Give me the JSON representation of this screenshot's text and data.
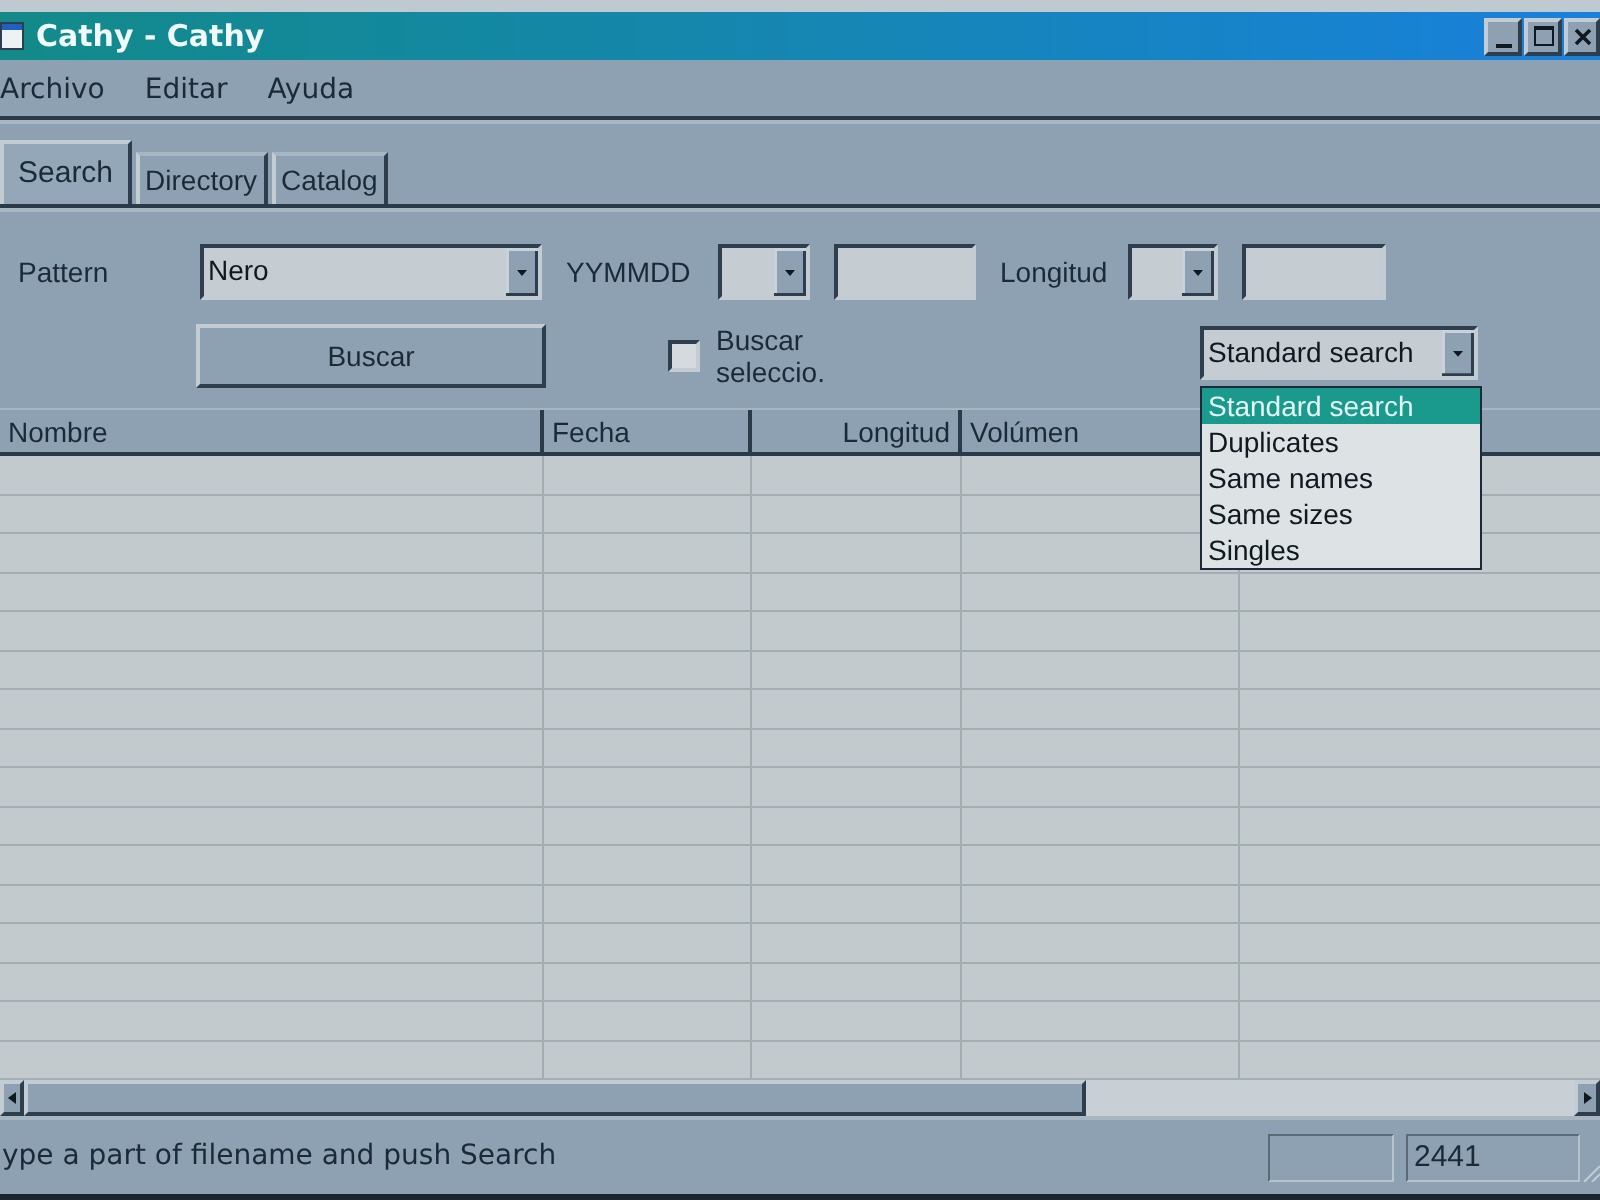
{
  "window": {
    "title": "Cathy - Cathy"
  },
  "menu": [
    "Archivo",
    "Editar",
    "Ayuda"
  ],
  "tabs": [
    {
      "label": "Search",
      "selected": true
    },
    {
      "label": "Directory",
      "selected": false
    },
    {
      "label": "Catalog",
      "selected": false
    }
  ],
  "search_form": {
    "pattern": {
      "label": "Pattern",
      "value": "Nero"
    },
    "date": {
      "label": "YYMMDD"
    },
    "length": {
      "label": "Longitud"
    },
    "search_button": {
      "label": "Buscar"
    },
    "search_selection": {
      "label": "Buscar seleccio.",
      "checked": false
    },
    "mode": {
      "value": "Standard search",
      "expanded": true,
      "options": [
        {
          "label": "Standard search",
          "selected": true
        },
        {
          "label": "Duplicates",
          "selected": false
        },
        {
          "label": "Same names",
          "selected": false
        },
        {
          "label": "Same sizes",
          "selected": false
        },
        {
          "label": "Singles",
          "selected": false
        }
      ]
    }
  },
  "table": {
    "columns": [
      "Nombre",
      "Fecha",
      "Longitud",
      "Volúmen"
    ]
  },
  "status_bar": {
    "message": "ype a part of filename and push Search",
    "count": "2441"
  }
}
